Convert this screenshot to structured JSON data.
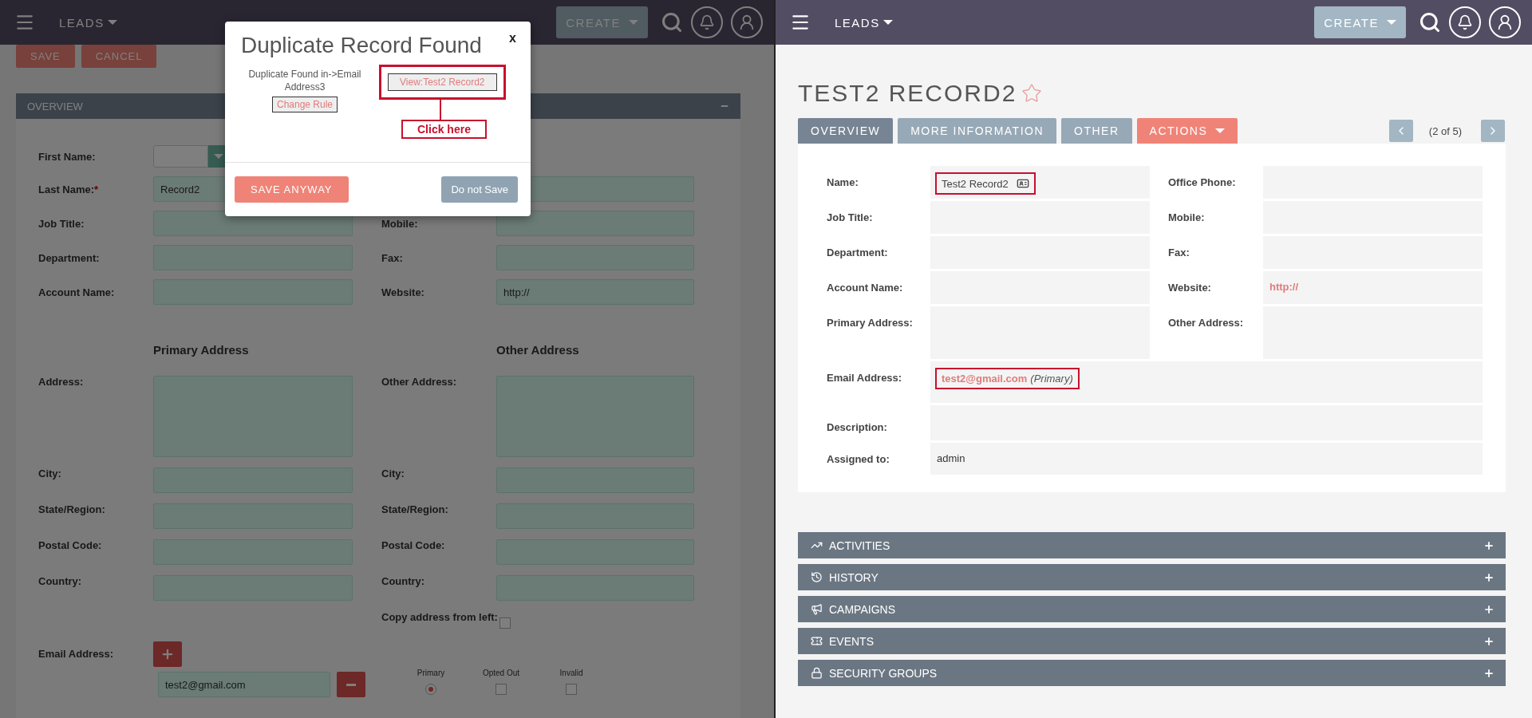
{
  "left_pane": {
    "header": {
      "module": "LEADS",
      "create": "CREATE"
    },
    "actions": [
      {
        "label": "SAVE"
      },
      {
        "label": "CANCEL"
      }
    ],
    "panel_title": "OVERVIEW",
    "top_rows": [
      {
        "left": {
          "label": "First Name:",
          "kind": "salutation"
        }
      },
      {
        "left": {
          "label": "Last Name:",
          "required_mark": "*",
          "kind": "input",
          "value": "Record2"
        },
        "right": {
          "kind": "input"
        }
      },
      {
        "left": {
          "label": "Job Title:",
          "kind": "input"
        },
        "right": {
          "label": "Mobile:",
          "kind": "input"
        }
      },
      {
        "left": {
          "label": "Department:",
          "kind": "input"
        },
        "right": {
          "label": "Fax:",
          "kind": "input"
        }
      },
      {
        "left": {
          "label": "Account Name:",
          "kind": "input"
        },
        "right": {
          "label": "Website:",
          "kind": "input",
          "value": "http://"
        }
      }
    ],
    "address_headings": [
      "Primary Address",
      "Other Address"
    ],
    "address_rows": [
      {
        "left": {
          "label": "Address:",
          "kind": "textarea"
        },
        "right": {
          "label": "Other Address:",
          "kind": "textarea"
        }
      },
      {
        "left": {
          "label": "City:",
          "kind": "input"
        },
        "right": {
          "label": "City:",
          "kind": "input"
        }
      },
      {
        "left": {
          "label": "State/Region:",
          "kind": "input"
        },
        "right": {
          "label": "State/Region:",
          "kind": "input"
        }
      },
      {
        "left": {
          "label": "Postal Code:",
          "kind": "input"
        },
        "right": {
          "label": "Postal Code:",
          "kind": "input"
        }
      },
      {
        "left": {
          "label": "Country:",
          "kind": "input"
        },
        "right": {
          "label": "Country:",
          "kind": "input"
        }
      }
    ],
    "copy_address": {
      "label": "Copy address from left:",
      "checked": false
    },
    "email": {
      "label": "Email Address:",
      "value": "test2@gmail.com",
      "options": [
        {
          "label": "Primary",
          "kind": "radio",
          "selected": true
        },
        {
          "label": "Opted Out",
          "kind": "checkbox",
          "checked": false
        },
        {
          "label": "Invalid",
          "kind": "checkbox",
          "checked": false
        }
      ]
    }
  },
  "dialog": {
    "title": "Duplicate Record Found",
    "close": "x",
    "message": "Duplicate Found in->Email Address3",
    "change_rule": "Change Rule",
    "view_link": {
      "label": "View:Test2 Record2",
      "highlighted": true
    },
    "callout": "Click here",
    "buttons": [
      {
        "label": "SAVE ANYWAY",
        "kind": "primary"
      },
      {
        "label": "Do not Save",
        "kind": "secondary"
      }
    ]
  },
  "right_pane": {
    "header": {
      "module": "LEADS",
      "create": "CREATE"
    },
    "title": "TEST2 RECORD2",
    "tabs": [
      {
        "label": "OVERVIEW",
        "kind": "tab",
        "selected": true
      },
      {
        "label": "MORE INFORMATION",
        "kind": "tab",
        "selected": false
      },
      {
        "label": "OTHER",
        "kind": "tab",
        "selected": false
      },
      {
        "label": "ACTIONS",
        "kind": "menu",
        "selected": false
      }
    ],
    "pager": "(2 of 5)",
    "pair_rows": [
      {
        "tall": false,
        "left": {
          "label": "Name:",
          "value": "Test2 Record2",
          "kind": "name",
          "highlighted": true
        },
        "right": {
          "label": "Office Phone:"
        }
      },
      {
        "tall": false,
        "left": {
          "label": "Job Title:"
        },
        "right": {
          "label": "Mobile:"
        }
      },
      {
        "tall": false,
        "left": {
          "label": "Department:"
        },
        "right": {
          "label": "Fax:"
        }
      },
      {
        "tall": false,
        "left": {
          "label": "Account Name:"
        },
        "right": {
          "label": "Website:",
          "value": "http://",
          "kind": "link"
        }
      },
      {
        "tall": true,
        "left": {
          "label": "Primary Address:"
        },
        "right": {
          "label": "Other Address:"
        }
      }
    ],
    "wide_rows": [
      {
        "label": "Email Address:",
        "value": "test2@gmail.com",
        "note": "(Primary)",
        "kind": "email",
        "highlighted": true
      },
      {
        "label": "Description:"
      },
      {
        "label": "Assigned to:",
        "value": "admin",
        "kind": "text"
      }
    ],
    "subpanels": [
      {
        "label": "ACTIVITIES",
        "kind": "activities"
      },
      {
        "label": "HISTORY",
        "kind": "history"
      },
      {
        "label": "CAMPAIGNS",
        "kind": "campaigns"
      },
      {
        "label": "EVENTS",
        "kind": "events"
      },
      {
        "label": "SECURITY GROUPS",
        "kind": "security"
      }
    ]
  }
}
